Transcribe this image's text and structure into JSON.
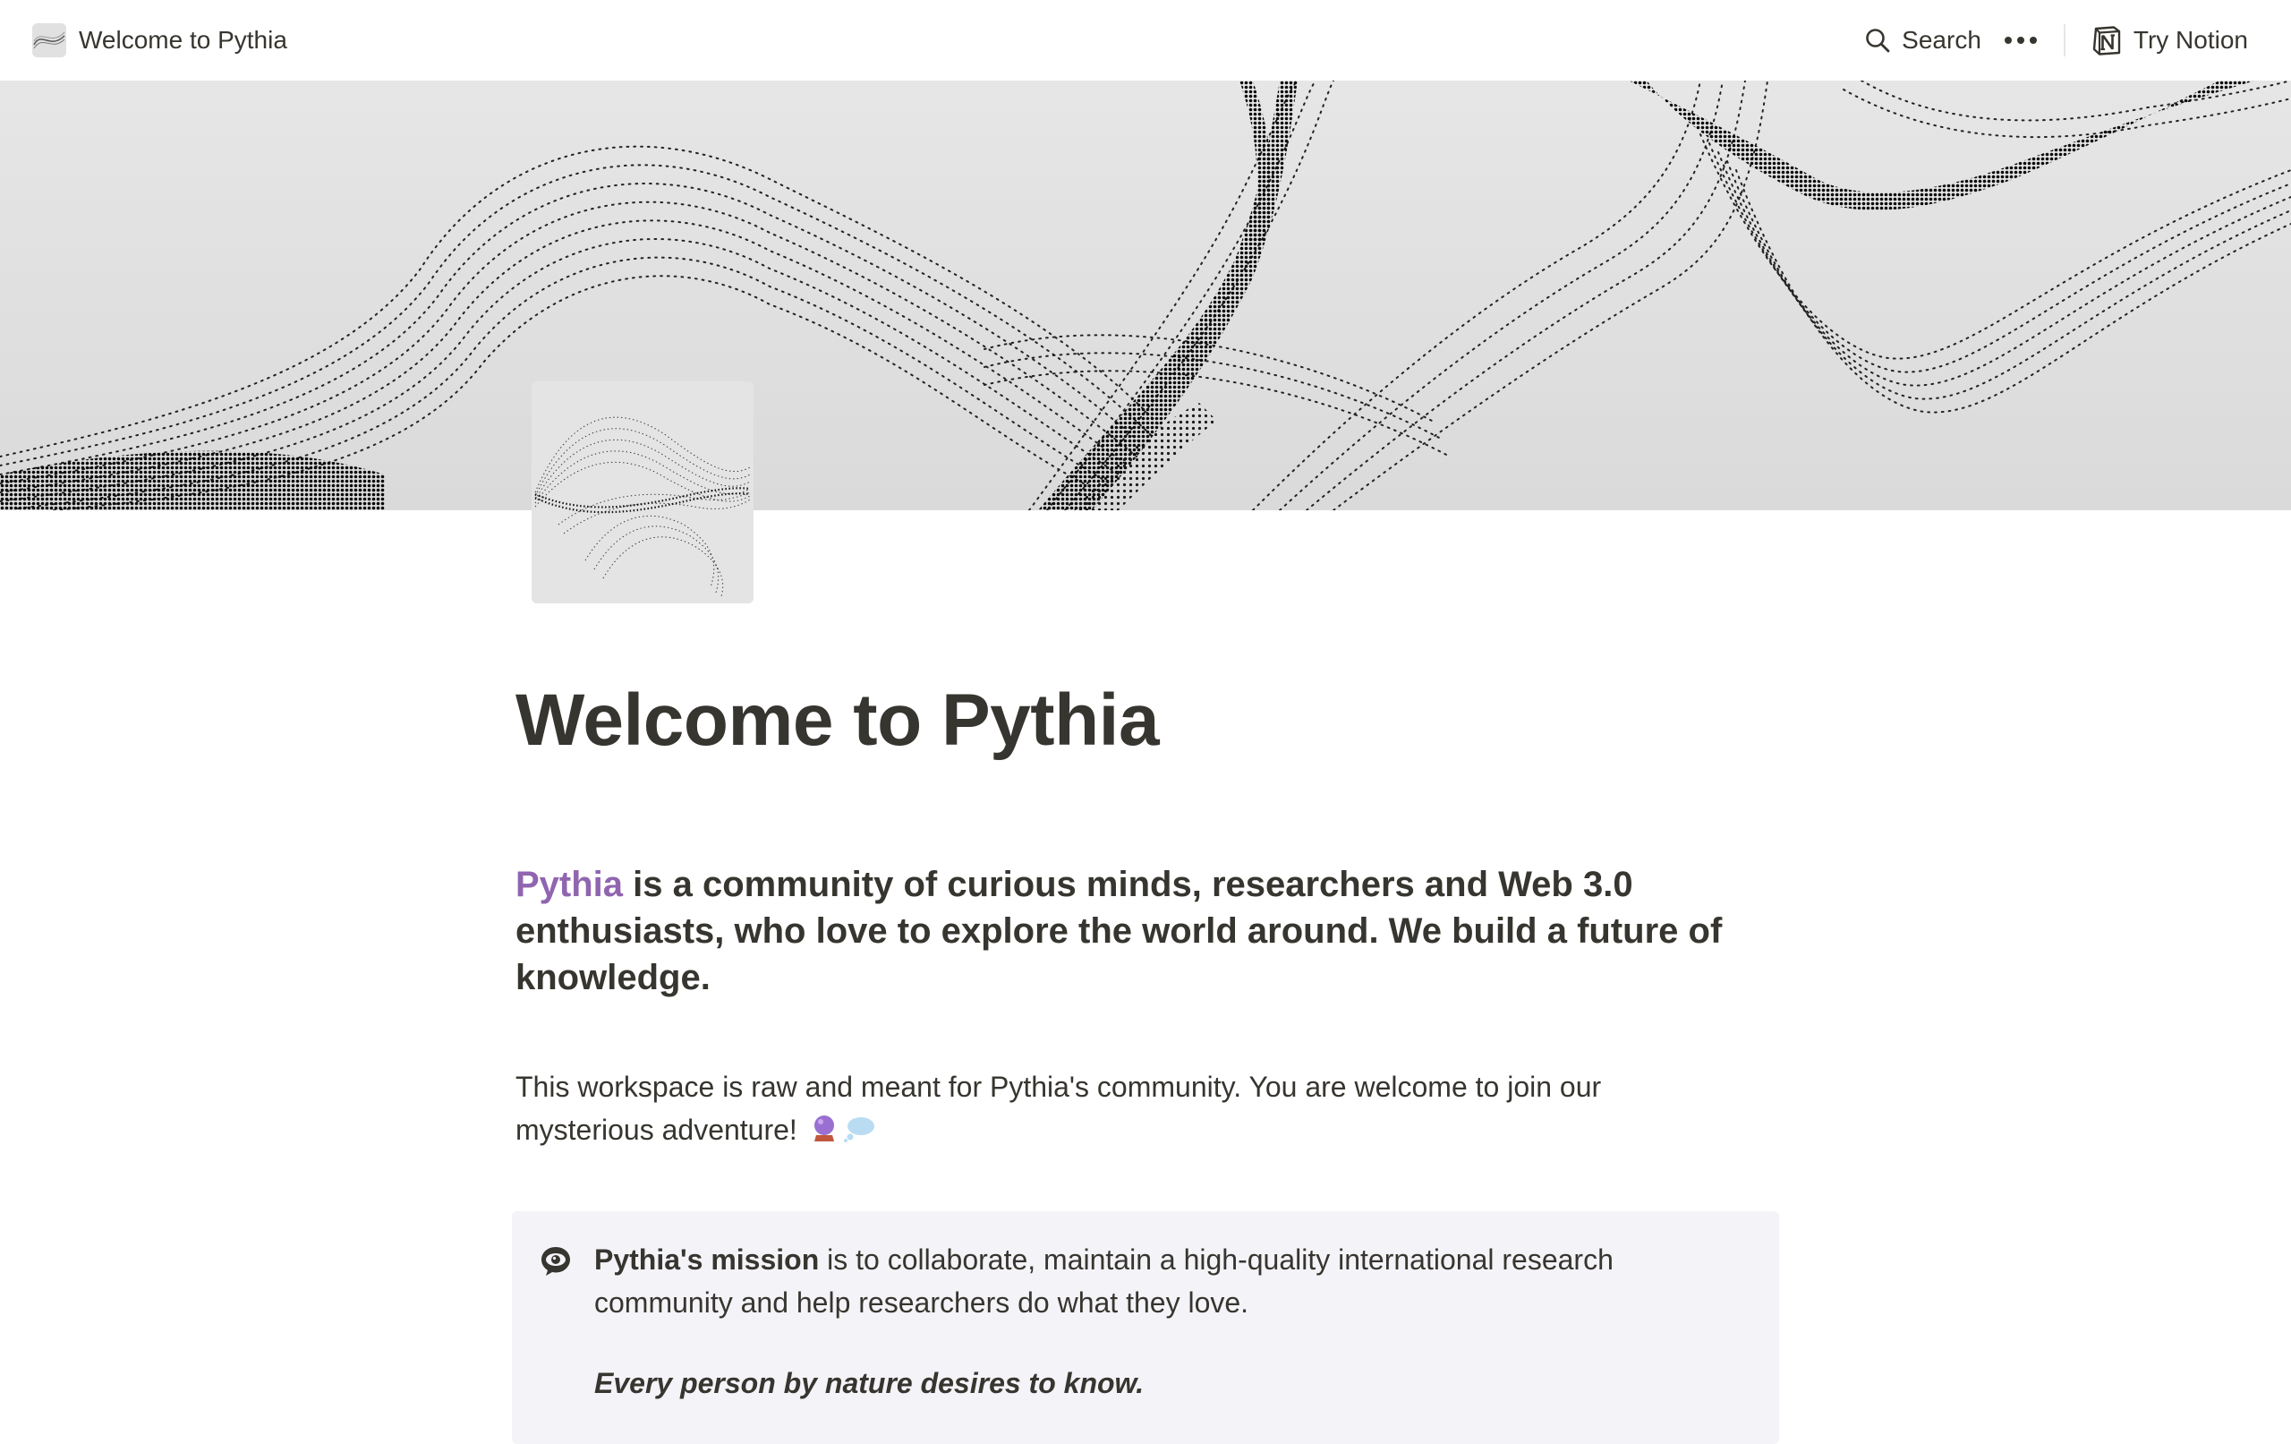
{
  "topbar": {
    "page_title": "Welcome to Pythia",
    "search_label": "Search",
    "try_notion_label": "Try Notion"
  },
  "page": {
    "title": "Welcome to Pythia",
    "lead_accent": "Pythia",
    "lead_rest": " is a community of curious minds, researchers and Web 3.0 enthusiasts, who love to explore the world around. We build a future of knowledge.",
    "paragraph": "This workspace is raw and meant for Pythia's community.  You are welcome to join our mysterious adventure!",
    "callout": {
      "bold": "Pythia's mission",
      "text": " is to collaborate, maintain a high-quality international research community and help researchers do what they love.",
      "quote": "Every person by nature desires to know."
    }
  },
  "icons": {
    "topbar_page_icon": "wave-thumbnail-icon",
    "search": "search-icon",
    "more": "more-dots-icon",
    "notion": "notion-logo-icon",
    "crystal_ball": "crystal-ball-icon",
    "thought": "thought-bubble-icon",
    "callout": "eye-speech-icon"
  },
  "colors": {
    "accent": "#9065b0",
    "text": "#37352f",
    "callout_bg": "#f4f3f7"
  }
}
